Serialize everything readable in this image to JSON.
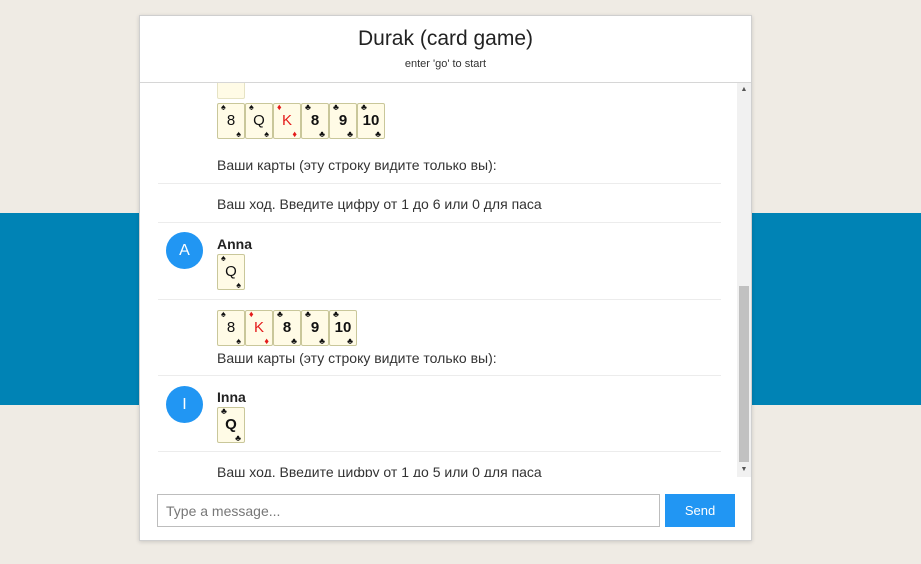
{
  "header": {
    "title": "Durak (card game)",
    "subtitle": "enter 'go' to start"
  },
  "messages": [
    {
      "type": "cards",
      "cards": [
        {
          "rank": "8",
          "suit": "♠",
          "color": "black",
          "bold": false
        },
        {
          "rank": "Q",
          "suit": "♠",
          "color": "black",
          "bold": false
        },
        {
          "rank": "K",
          "suit": "♦",
          "color": "red",
          "bold": false
        },
        {
          "rank": "8",
          "suit": "♣",
          "color": "black",
          "bold": true
        },
        {
          "rank": "9",
          "suit": "♣",
          "color": "black",
          "bold": true
        },
        {
          "rank": "10",
          "suit": "♣",
          "color": "black",
          "bold": true
        }
      ],
      "text": "Ваши карты (эту строку видите только вы):"
    },
    {
      "type": "text",
      "text": "Ваш ход. Введите цифру от 1 до 6 или 0 для паса"
    },
    {
      "type": "user",
      "author": "Anna",
      "avatar": "A",
      "cards": [
        {
          "rank": "Q",
          "suit": "♠",
          "color": "black",
          "bold": false
        }
      ]
    },
    {
      "type": "cards",
      "cards": [
        {
          "rank": "8",
          "suit": "♠",
          "color": "black",
          "bold": false
        },
        {
          "rank": "K",
          "suit": "♦",
          "color": "red",
          "bold": false
        },
        {
          "rank": "8",
          "suit": "♣",
          "color": "black",
          "bold": true
        },
        {
          "rank": "9",
          "suit": "♣",
          "color": "black",
          "bold": true
        },
        {
          "rank": "10",
          "suit": "♣",
          "color": "black",
          "bold": true
        }
      ],
      "text": "Ваши карты (эту строку видите только вы):"
    },
    {
      "type": "user",
      "author": "Inna",
      "avatar": "I",
      "cards": [
        {
          "rank": "Q",
          "suit": "♣",
          "color": "black",
          "bold": true
        }
      ]
    },
    {
      "type": "text",
      "text": "Ваш ход. Введите цифру от 1 до 5 или 0 для паса"
    }
  ],
  "composer": {
    "placeholder": "Type a message...",
    "send_label": "Send"
  },
  "colors": {
    "accent": "#2196f3",
    "band": "#0083b5",
    "background": "#efebe4",
    "red_suit": "#e41b1b",
    "card_face": "#fffbe6"
  },
  "icons": {
    "scroll_up": "scroll-up-arrow-icon",
    "scroll_down": "scroll-down-arrow-icon"
  }
}
